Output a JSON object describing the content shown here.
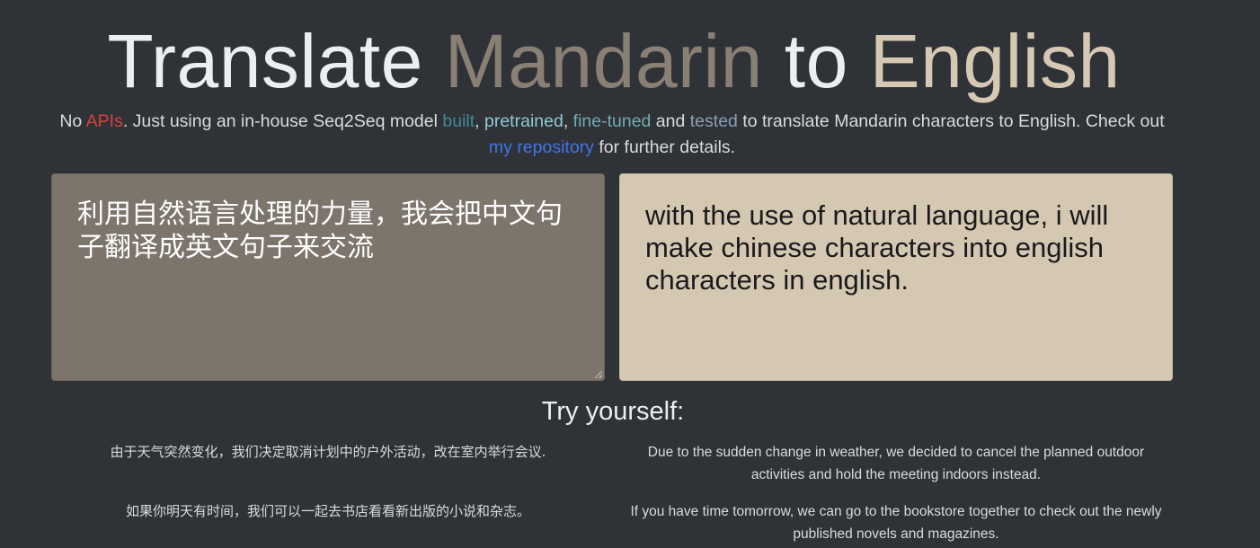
{
  "header": {
    "title_word_1": "Translate",
    "title_word_2": "Mandarin",
    "title_word_3": "to",
    "title_word_4": "English"
  },
  "intro": {
    "text_1": "No ",
    "link_apis": "APIs",
    "text_2": ". Just using an in-house Seq2Seq model ",
    "link_built": "built",
    "text_3": ", ",
    "link_pretrained": "pretrained",
    "text_4": ", ",
    "link_finetuned": "fine-tuned",
    "text_5": " and ",
    "link_tested": "tested",
    "text_6": " to translate Mandarin characters to English. Check out ",
    "link_repository": "my repository",
    "text_7": " for further details."
  },
  "translator": {
    "input_value": "利用自然语言处理的力量，我会把中文句子翻译成英文句子来交流",
    "output_value": "with the use of natural language, i will make chinese characters into english characters in english."
  },
  "examples": {
    "heading": "Try yourself:",
    "items": [
      {
        "mandarin": "由于天气突然变化，我们决定取消计划中的户外活动，改在室内举行会议.",
        "english": "Due to the sudden change in weather, we decided to cancel the planned outdoor activities and hold the meeting indoors instead."
      },
      {
        "mandarin": "如果你明天有时间，我们可以一起去书店看看新出版的小说和杂志。",
        "english": "If you have time tomorrow, we can go to the bookstore together to check out the newly published novels and magazines."
      }
    ]
  },
  "colors": {
    "background": "#2f3237",
    "source_accent": "#8a7f74",
    "target_accent": "#d6c8b2",
    "input_panel": "#7d756c",
    "output_panel": "#d5c8b3",
    "link_apis": "#d9423c",
    "link_repository": "#3f76e6"
  }
}
